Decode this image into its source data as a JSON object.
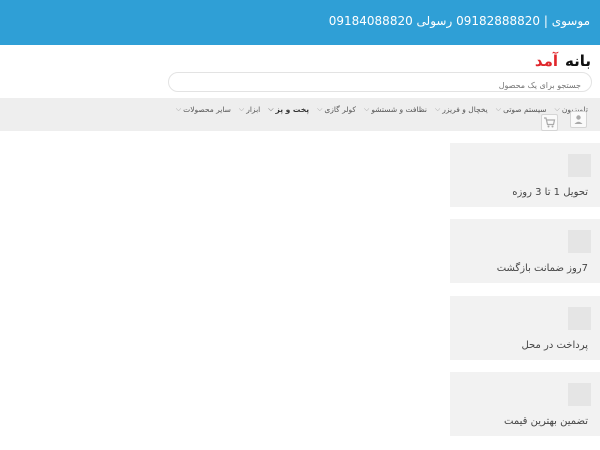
{
  "header": {
    "phones": "09184088820 موسوی | 09182888820 رسولی",
    "logo_text": "بانه آمد"
  },
  "search": {
    "placeholder": "جستجو برای یک محصول"
  },
  "nav": {
    "items": [
      {
        "label": "تلویزیون",
        "bold": false
      },
      {
        "label": "سیستم صوتی",
        "bold": false
      },
      {
        "label": "یخچال و فریزر",
        "bold": false
      },
      {
        "label": "نظافت و شستشو",
        "bold": false
      },
      {
        "label": "کولر گازی",
        "bold": false
      },
      {
        "label": "پخت و پز",
        "bold": true
      },
      {
        "label": "ابزار",
        "bold": false
      },
      {
        "label": "سایر محصولات",
        "bold": false
      }
    ],
    "user_icon": "user-icon",
    "cart_icon": "cart-icon"
  },
  "features": [
    {
      "label": "تحویل 1 تا 3 روزه"
    },
    {
      "label": "7روز ضمانت بازگشت"
    },
    {
      "label": "پرداخت در محل"
    },
    {
      "label": "تضمین بهترین قیمت"
    }
  ]
}
